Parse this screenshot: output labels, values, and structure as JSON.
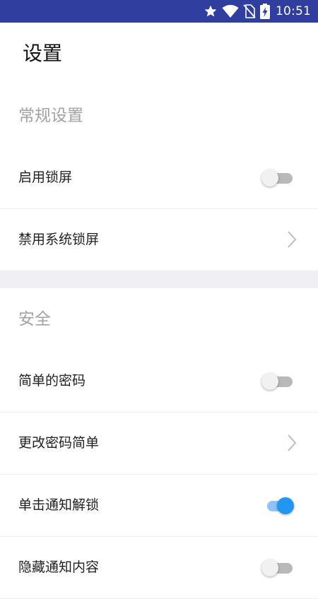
{
  "status_bar": {
    "time": "10:51",
    "icons": [
      "star-icon",
      "wifi-icon",
      "no-sim-icon",
      "battery-charging-icon"
    ]
  },
  "header": {
    "title": "设置"
  },
  "sections": [
    {
      "title": "常规设置",
      "rows": [
        {
          "label": "启用锁屏",
          "control": "toggle",
          "on": false
        },
        {
          "label": "禁用系统锁屏",
          "control": "chevron-right-icon"
        }
      ]
    },
    {
      "title": "安全",
      "rows": [
        {
          "label": "简单的密码",
          "control": "toggle",
          "on": false
        },
        {
          "label": "更改密码简单",
          "control": "chevron-right-icon"
        },
        {
          "label": "单击通知解锁",
          "control": "toggle",
          "on": true
        },
        {
          "label": "隐藏通知内容",
          "control": "toggle",
          "on": false
        }
      ]
    }
  ],
  "colors": {
    "status_bar": "#303f9f",
    "toggle_on": "#2196f3",
    "toggle_off": "#b9b9b9",
    "section_gap": "#efeff4"
  }
}
